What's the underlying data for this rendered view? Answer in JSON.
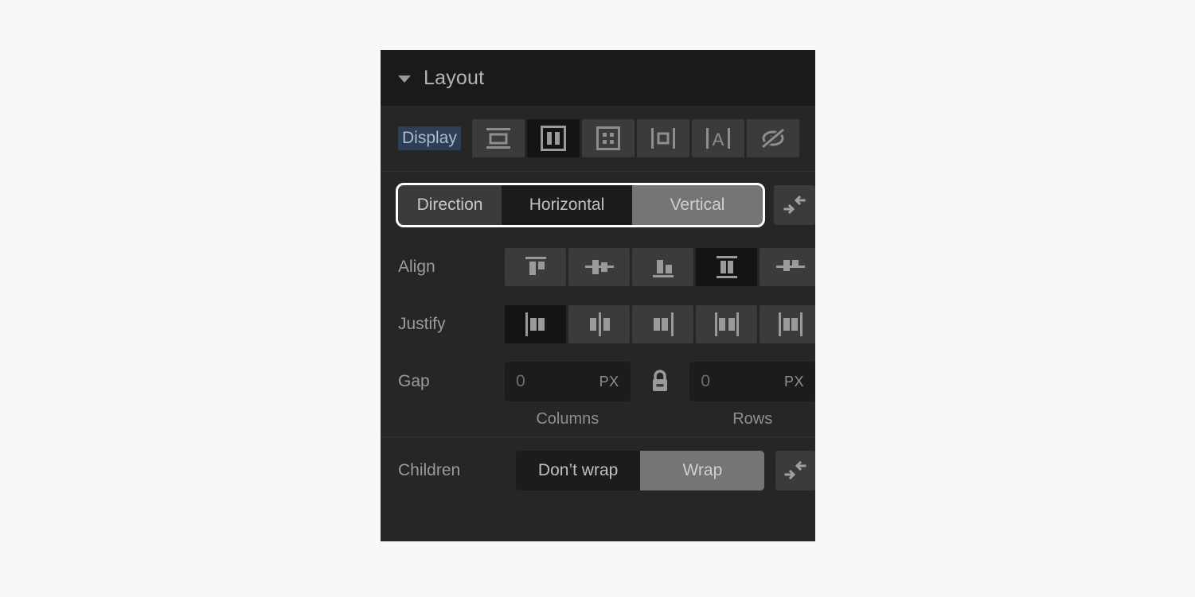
{
  "panel": {
    "header": {
      "title": "Layout",
      "caret_icon": "chevron-down-icon"
    },
    "display": {
      "label": "Display",
      "label_selected": true,
      "options": [
        {
          "value": "block",
          "icon": "display-block-icon",
          "selected": false
        },
        {
          "value": "flex",
          "icon": "display-flex-icon",
          "selected": true
        },
        {
          "value": "grid",
          "icon": "display-grid-icon",
          "selected": false
        },
        {
          "value": "inline-block",
          "icon": "display-inline-block-icon",
          "selected": false
        },
        {
          "value": "inline",
          "icon": "display-inline-icon",
          "selected": false
        },
        {
          "value": "none",
          "icon": "display-none-icon",
          "selected": false
        }
      ]
    },
    "direction": {
      "label": "Direction",
      "focused": true,
      "options": [
        {
          "label": "Horizontal",
          "selected": false
        },
        {
          "label": "Vertical",
          "selected": true
        }
      ],
      "reverse_icon": "arrows-collapse-icon"
    },
    "align": {
      "label": "Align",
      "options": [
        {
          "value": "flex-start",
          "icon": "align-start-icon",
          "selected": false
        },
        {
          "value": "center",
          "icon": "align-center-icon",
          "selected": false
        },
        {
          "value": "flex-end",
          "icon": "align-end-icon",
          "selected": false
        },
        {
          "value": "stretch",
          "icon": "align-stretch-icon",
          "selected": true
        },
        {
          "value": "baseline",
          "icon": "align-baseline-icon",
          "selected": false
        }
      ]
    },
    "justify": {
      "label": "Justify",
      "options": [
        {
          "value": "flex-start",
          "icon": "justify-start-icon",
          "selected": true
        },
        {
          "value": "center",
          "icon": "justify-center-icon",
          "selected": false
        },
        {
          "value": "flex-end",
          "icon": "justify-end-icon",
          "selected": false
        },
        {
          "value": "space-between",
          "icon": "justify-space-between-icon",
          "selected": false
        },
        {
          "value": "space-around",
          "icon": "justify-space-around-icon",
          "selected": false
        }
      ]
    },
    "gap": {
      "label": "Gap",
      "lock_icon": "lock-closed-icon",
      "locked": true,
      "columns": {
        "value": "0",
        "unit": "PX",
        "sub_label": "Columns"
      },
      "rows": {
        "value": "0",
        "unit": "PX",
        "sub_label": "Rows"
      }
    },
    "children": {
      "label": "Children",
      "options": [
        {
          "label": "Don’t wrap",
          "selected": true
        },
        {
          "label": "Wrap",
          "selected": false
        }
      ],
      "reverse_icon": "arrows-collapse-icon"
    }
  },
  "colors": {
    "page_background": "#f7f8f9",
    "panel_background": "#262626",
    "header_background": "#1a1a1a",
    "control_background": "#3b3b3b",
    "active_background": "#141414",
    "selected_segment": "#757575",
    "selection_highlight": "#2e3e55",
    "focus_ring": "#ffffff",
    "text_primary": "#c8c8c8",
    "text_muted": "#9b9b9b"
  }
}
